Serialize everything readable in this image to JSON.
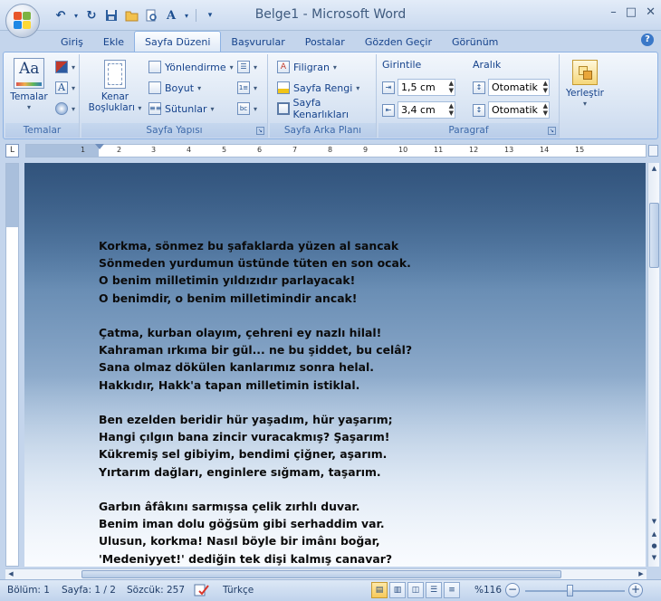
{
  "window": {
    "title": "Belge1 - Microsoft Word",
    "controls": [
      "–",
      "□",
      "✕"
    ]
  },
  "tabs": [
    "Giriş",
    "Ekle",
    "Sayfa Düzeni",
    "Başvurular",
    "Postalar",
    "Gözden Geçir",
    "Görünüm"
  ],
  "active_tab": "Sayfa Düzeni",
  "ribbon": {
    "temalar": {
      "button": "Temalar",
      "group": "Temalar"
    },
    "sayfa_yapisi": {
      "kenar": "Kenar",
      "bosluklari": "Boşlukları",
      "yonlendirme": "Yönlendirme",
      "boyut": "Boyut",
      "sutunlar": "Sütunlar",
      "group": "Sayfa Yapısı"
    },
    "sayfa_arka_plani": {
      "filigran": "Filigran",
      "sayfa_rengi": "Sayfa Rengi",
      "sayfa_kenarliklari": "Sayfa Kenarlıkları",
      "group": "Sayfa Arka Planı"
    },
    "paragraf": {
      "girintile": "Girintile",
      "aralik": "Aralık",
      "indent_left": "1,5 cm",
      "indent_right": "3,4 cm",
      "spacing_before": "Otomatik",
      "spacing_after": "Otomatik",
      "group": "Paragraf"
    },
    "yerlestir": {
      "button": "Yerleştir"
    }
  },
  "ruler": [
    "1",
    "2",
    "3",
    "4",
    "5",
    "6",
    "7",
    "8",
    "9",
    "10",
    "11",
    "12",
    "13",
    "14",
    "15"
  ],
  "poem": [
    [
      "Korkma, sönmez bu şafaklarda  yüzen al sancak",
      "Sönmeden yurdumun üstünde tüten en son ocak.",
      "O benim milletimin yıldızıdır parlayacak!",
      "O benimdir, o benim milletimindir ancak!"
    ],
    [
      "Çatma, kurban olayım, çehreni ey nazlı hilal!",
      "Kahraman ırkıma bir gül... ne bu şiddet, bu celâl?",
      "Sana olmaz dökülen kanlarımız sonra helal.",
      "Hakkıdır, Hakk'a tapan milletimin istiklal."
    ],
    [
      "Ben ezelden beridir hür yaşadım, hür yaşarım;",
      "Hangi çılgın bana zincir vuracakmış? Şaşarım!",
      "Kükremiş sel gibiyim, bendimi çiğner, aşarım.",
      "Yırtarım dağları, enginlere sığmam, taşarım."
    ],
    [
      "Garbın âfâkını  sarmışsa çelik zırhlı duvar.",
      "Benim iman dolu göğsüm gibi serhaddim var.",
      "Ulusun, korkma! Nasıl böyle bir imânı boğar,",
      "'Medeniyyet!' dediğin tek dişi kalmış canavar?"
    ]
  ],
  "status": {
    "bolum": "Bölüm: 1",
    "sayfa": "Sayfa: 1 / 2",
    "sozcuk": "Sözcük: 257",
    "dil": "Türkçe",
    "zoom": "%116"
  },
  "colors": {
    "ribbon_border": "#8db2e3",
    "text_blue": "#15428b",
    "active_view": "#f7c95a"
  }
}
